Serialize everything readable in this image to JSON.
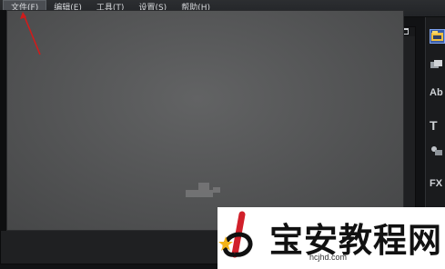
{
  "menubar": {
    "items": [
      {
        "label": "文件(F)"
      },
      {
        "label": "编辑(E)"
      },
      {
        "label": "工具(T)"
      },
      {
        "label": "设置(S)"
      },
      {
        "label": "帮助(H)"
      }
    ]
  },
  "toolbar": {
    "tools": [
      {
        "icon": "media-icon",
        "glyph": ""
      },
      {
        "icon": "transition-icon",
        "glyph": ""
      },
      {
        "icon": "title-icon",
        "glyph": "Ab"
      },
      {
        "icon": "text-icon",
        "glyph": "T"
      },
      {
        "icon": "graphic-icon",
        "glyph": ""
      },
      {
        "icon": "filter-icon",
        "glyph": "FX"
      }
    ]
  },
  "watermark": {
    "text": "宝安教程网",
    "url": "hcjhd.com"
  },
  "colors": {
    "accent": "#3a5da8",
    "annotation_arrow": "#d11b1b"
  }
}
